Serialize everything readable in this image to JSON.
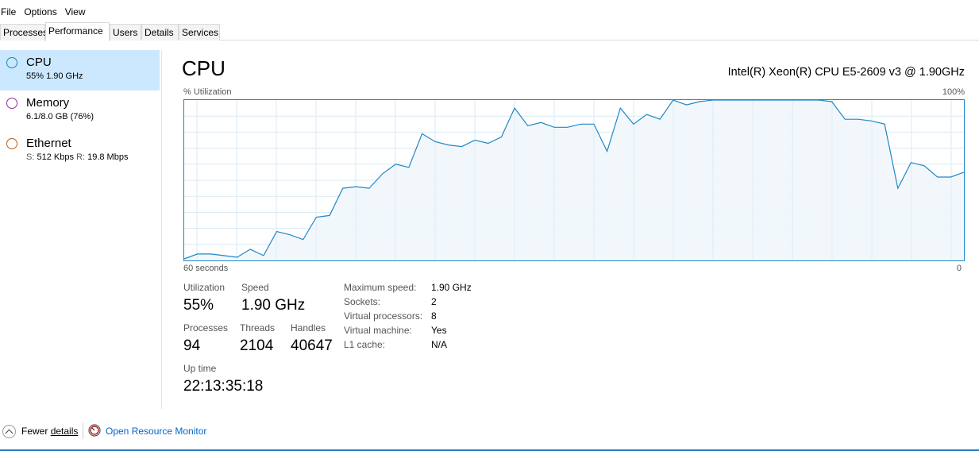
{
  "menu": [
    "File",
    "Options",
    "View"
  ],
  "tabs": [
    "Processes",
    "Performance",
    "Users",
    "Details",
    "Services"
  ],
  "sidebar": {
    "items": [
      {
        "name": "CPU",
        "sub": "55% 1.90 GHz",
        "color": "#1585c7",
        "selected": true
      },
      {
        "name": "Memory",
        "sub": "6.1/8.0 GB (76%)",
        "color": "#8b2f9a",
        "selected": false
      },
      {
        "name": "Ethernet",
        "sub_send_label": "S:",
        "sub_send": "512 Kbps",
        "sub_recv_label": "R:",
        "sub_recv": "19.8 Mbps",
        "color": "#b35d1a",
        "selected": false
      }
    ]
  },
  "main": {
    "title": "CPU",
    "model": "Intel(R) Xeon(R) CPU E5-2609 v3 @ 1.90GHz",
    "util_axis_label": "% Utilization",
    "max_label": "100%",
    "time_label": "60 seconds",
    "zero_label": "0",
    "stats": {
      "utilization_label": "Utilization",
      "utilization": "55%",
      "speed_label": "Speed",
      "speed": "1.90 GHz",
      "processes_label": "Processes",
      "processes": "94",
      "threads_label": "Threads",
      "threads": "2104",
      "handles_label": "Handles",
      "handles": "40647",
      "uptime_label": "Up time",
      "uptime": "22:13:35:18"
    },
    "info": [
      {
        "label": "Maximum speed:",
        "value": "1.90 GHz"
      },
      {
        "label": "Sockets:",
        "value": "2"
      },
      {
        "label": "Virtual processors:",
        "value": "8"
      },
      {
        "label": "Virtual machine:",
        "value": "Yes"
      },
      {
        "label": "L1 cache:",
        "value": "N/A"
      }
    ]
  },
  "chart_data": {
    "type": "area",
    "ylim": [
      0,
      100
    ],
    "xlim": [
      60,
      0
    ],
    "line_color": "#1f87c6",
    "fill_color": "#f1f6fb",
    "grid_color": "#d9eaf4",
    "values": [
      1,
      4,
      4,
      3,
      2,
      7,
      3,
      18,
      16,
      13,
      27,
      28,
      45,
      46,
      45,
      54,
      60,
      58,
      79,
      74,
      72,
      71,
      75,
      73,
      77,
      95,
      84,
      86,
      83,
      83,
      85,
      85,
      68,
      95,
      85,
      91,
      88,
      100,
      97,
      99,
      100,
      100,
      100,
      100,
      100,
      100,
      100,
      100,
      100,
      99,
      88,
      88,
      87,
      85,
      45,
      61,
      59,
      52,
      52,
      55
    ]
  },
  "footer": {
    "fewer_prefix": "Fewer ",
    "fewer_underlined": "details",
    "open_rm": "Open Resource Monitor"
  }
}
